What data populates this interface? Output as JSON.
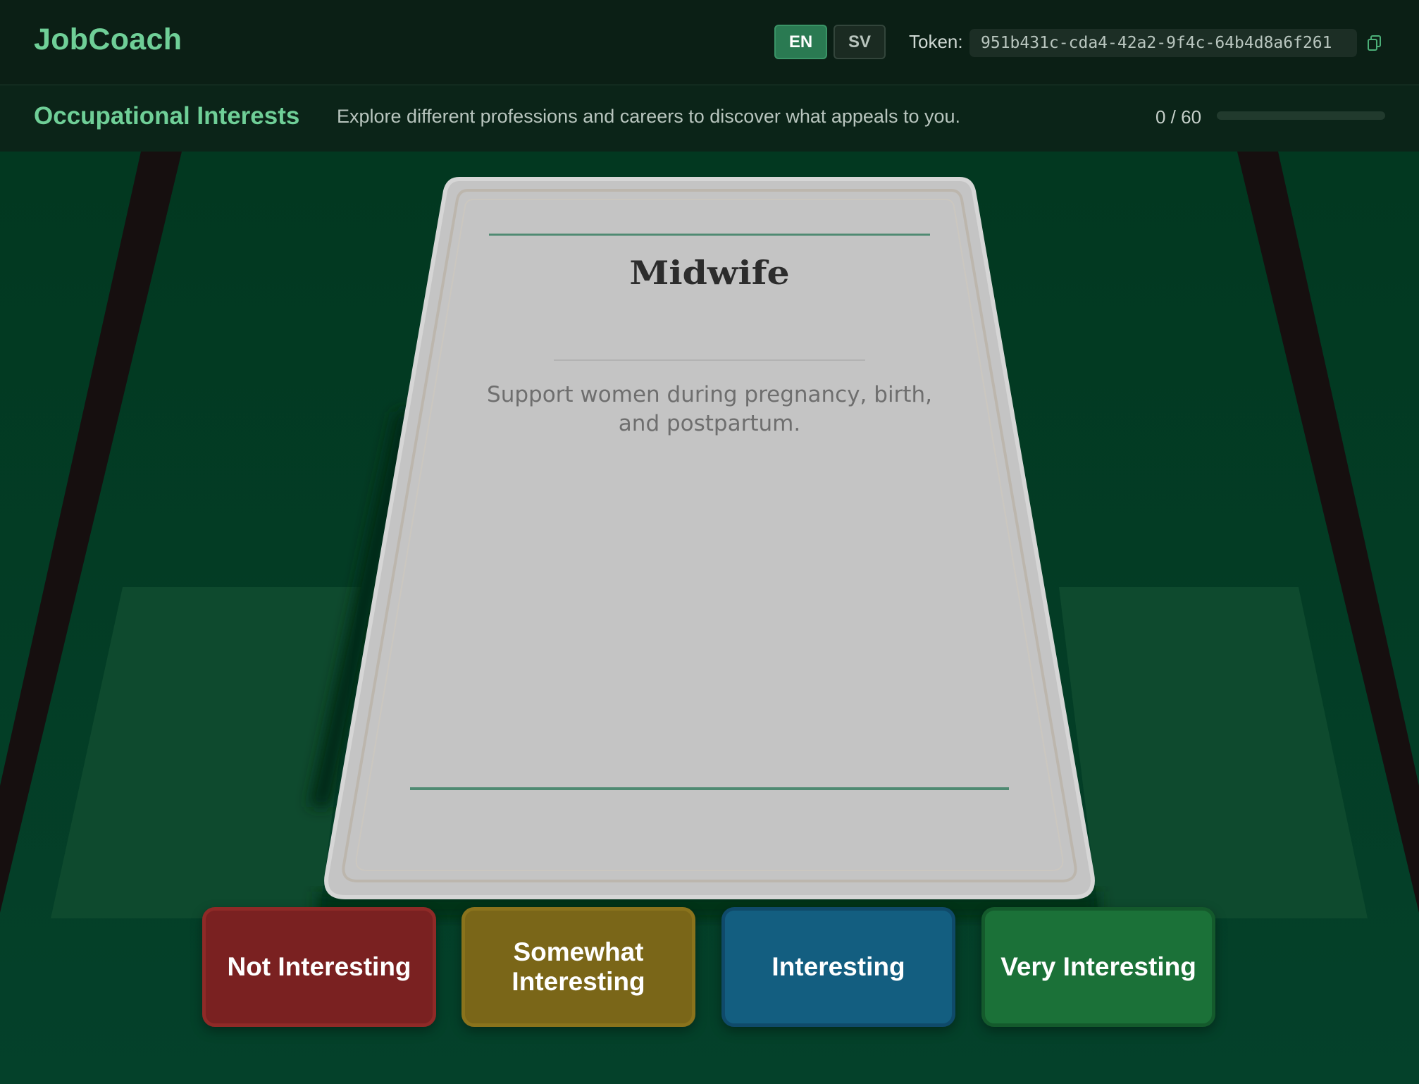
{
  "app": {
    "brand": "JobCoach"
  },
  "header": {
    "languages": [
      {
        "code": "EN",
        "active": true
      },
      {
        "code": "SV",
        "active": false
      }
    ],
    "token_label": "Token:",
    "token_value": "951b431c-cda4-42a2-9f4c-64b4d8a6f261",
    "copy_icon": "copy-icon"
  },
  "section": {
    "title": "Occupational Interests",
    "description": "Explore different professions and careers to discover what appeals to you.",
    "progress_text": "0 / 60",
    "progress_fraction": 0
  },
  "card": {
    "title": "Midwife",
    "description": "Support women during pregnancy, birth, and postpartum."
  },
  "ratings": [
    {
      "label": "Not Interesting",
      "color": "#7a2121"
    },
    {
      "label": "Somewhat Interesting",
      "color": "#7a6618"
    },
    {
      "label": "Interesting",
      "color": "#135e80"
    },
    {
      "label": "Very Interesting",
      "color": "#1b7138"
    }
  ],
  "colors": {
    "accent": "#6fcf97",
    "table": "#033a21",
    "header_bg": "#0b1f15"
  }
}
